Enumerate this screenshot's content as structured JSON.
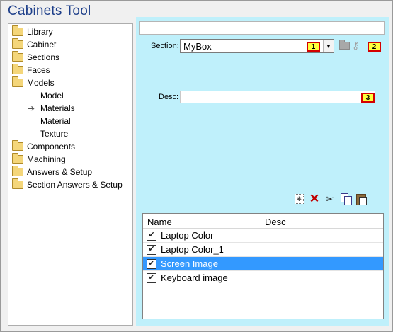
{
  "app": {
    "title": "Cabinets Tool"
  },
  "tree": {
    "items": [
      {
        "label": "Library",
        "icon": "folder-icon",
        "indent": 0
      },
      {
        "label": "Cabinet",
        "icon": "folder-icon",
        "indent": 0
      },
      {
        "label": "Sections",
        "icon": "folder-icon",
        "indent": 0
      },
      {
        "label": "Faces",
        "icon": "folder-icon",
        "indent": 0
      },
      {
        "label": "Models",
        "icon": "folder-icon",
        "indent": 0
      },
      {
        "label": "Model",
        "icon": "none",
        "indent": 1
      },
      {
        "label": "Materials",
        "icon": "arrow-right-icon",
        "indent": 1,
        "selected": true
      },
      {
        "label": "Material",
        "icon": "none",
        "indent": 1
      },
      {
        "label": "Texture",
        "icon": "none",
        "indent": 1
      },
      {
        "label": "Components",
        "icon": "folder-icon",
        "indent": 0
      },
      {
        "label": "Machining",
        "icon": "folder-icon",
        "indent": 0
      },
      {
        "label": "Answers & Setup",
        "icon": "folder-icon",
        "indent": 0
      },
      {
        "label": "Section Answers & Setup",
        "icon": "folder-icon",
        "indent": 0
      }
    ]
  },
  "form": {
    "top_field": {
      "value": ""
    },
    "section": {
      "label": "Section:",
      "value": "MyBox"
    },
    "desc": {
      "label": "Desc:",
      "value": ""
    },
    "badges": [
      "1",
      "2",
      "3"
    ]
  },
  "toolbar": {
    "icons": [
      "new-icon",
      "delete-icon",
      "cut-icon",
      "copy-icon",
      "paste-icon"
    ]
  },
  "grid": {
    "columns": [
      "Name",
      "Desc"
    ],
    "rows": [
      {
        "name": "Laptop Color",
        "desc": "",
        "checked": true,
        "selected": false
      },
      {
        "name": "Laptop Color_1",
        "desc": "",
        "checked": true,
        "selected": false
      },
      {
        "name": "Screen Image",
        "desc": "",
        "checked": true,
        "selected": true
      },
      {
        "name": "Keyboard image",
        "desc": "",
        "checked": true,
        "selected": false
      }
    ]
  },
  "colors": {
    "panel_bg": "#bff0fb",
    "title_text": "#1e3f8a",
    "selection": "#3399ff",
    "badge_fill": "#ffff3c",
    "badge_border": "#d40000"
  }
}
